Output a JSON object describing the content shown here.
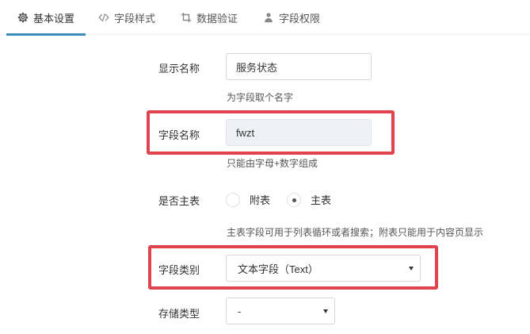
{
  "tabs": [
    {
      "label": "基本设置",
      "icon": "gear-icon",
      "active": true
    },
    {
      "label": "字段样式",
      "icon": "code-icon",
      "active": false
    },
    {
      "label": "数据验证",
      "icon": "crop-icon",
      "active": false
    },
    {
      "label": "字段权限",
      "icon": "user-icon",
      "active": false
    }
  ],
  "form": {
    "display_name": {
      "label": "显示名称",
      "value": "服务状态",
      "help": "为字段取个名字"
    },
    "field_name": {
      "label": "字段名称",
      "value": "fwzt",
      "help": "只能由字母+数字组成"
    },
    "is_main_table": {
      "label": "是否主表",
      "options": [
        {
          "label": "附表",
          "checked": false
        },
        {
          "label": "主表",
          "checked": true
        }
      ],
      "help": "主表字段可用于列表循环或者搜索；附表只能用于内容页显示"
    },
    "field_type": {
      "label": "字段类别",
      "value": "文本字段（Text）"
    },
    "storage_type": {
      "label": "存储类型",
      "value": "-"
    }
  },
  "colors": {
    "accent": "#3c8dbc",
    "highlight": "#e0444e"
  }
}
